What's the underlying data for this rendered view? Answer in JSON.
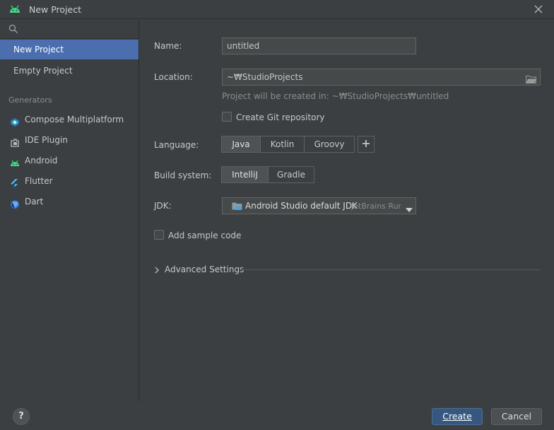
{
  "window": {
    "title": "New Project",
    "icon": "android-icon",
    "close_icon": "close-icon"
  },
  "sidebar": {
    "search_placeholder": "",
    "items": [
      {
        "label": "New Project",
        "selected": true
      },
      {
        "label": "Empty Project",
        "selected": false
      }
    ],
    "generators_label": "Generators",
    "generators": [
      {
        "label": "Compose Multiplatform",
        "icon": "compose-multiplatform-icon"
      },
      {
        "label": "IDE Plugin",
        "icon": "plugin-icon"
      },
      {
        "label": "Android",
        "icon": "android-icon"
      },
      {
        "label": "Flutter",
        "icon": "flutter-icon"
      },
      {
        "label": "Dart",
        "icon": "dart-icon"
      }
    ]
  },
  "form": {
    "name_label": "Name:",
    "name_value": "untitled",
    "location_label": "Location:",
    "location_value": "~₩StudioProjects",
    "location_hint": "Project will be created in: ~₩StudioProjects₩untitled",
    "git_label": "Create Git repository",
    "git_checked": false,
    "language_label": "Language:",
    "languages": [
      "Java",
      "Kotlin",
      "Groovy"
    ],
    "language_selected": "Java",
    "build_label": "Build system:",
    "build_systems": [
      "IntelliJ",
      "Gradle"
    ],
    "build_selected": "IntelliJ",
    "jdk_label": "JDK:",
    "jdk_value": "Android Studio default JDK",
    "jdk_detail": "JetBrains Runtime",
    "sample_label": "Add sample code",
    "sample_checked": false,
    "advanced_label": "Advanced Settings"
  },
  "footer": {
    "help_label": "?",
    "create_label": "Create",
    "cancel_label": "Cancel"
  },
  "colors": {
    "background": "#3c3f41",
    "selection": "#4b6eaf",
    "primary_button": "#365880",
    "android_green": "#3ddc84"
  }
}
